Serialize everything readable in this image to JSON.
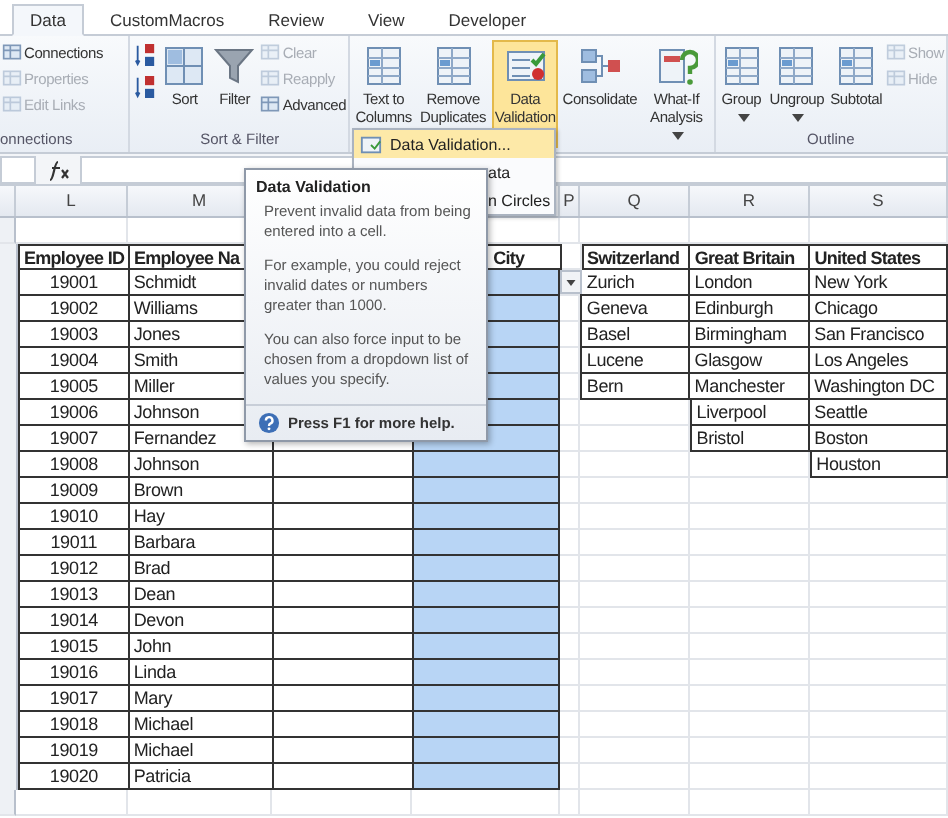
{
  "ribbon": {
    "tabs": [
      {
        "label": "Data",
        "selected": true
      },
      {
        "label": "CustomMacros",
        "selected": false
      },
      {
        "label": "Review",
        "selected": false
      },
      {
        "label": "View",
        "selected": false
      },
      {
        "label": "Developer",
        "selected": false
      }
    ],
    "groups": [
      {
        "label": "onnections",
        "items": [
          {
            "kind": "small",
            "label": "Connections",
            "disabled": false
          },
          {
            "kind": "small",
            "label": "Properties",
            "disabled": true
          },
          {
            "kind": "small",
            "label": "Edit Links",
            "disabled": true
          }
        ]
      },
      {
        "label": "Sort & Filter",
        "items": [
          {
            "kind": "icon"
          },
          {
            "kind": "icon"
          },
          {
            "kind": "large",
            "label": "Sort",
            "dropdown": false,
            "pressed": false
          },
          {
            "kind": "large",
            "label": "Filter",
            "dropdown": false,
            "pressed": false
          },
          {
            "kind": "small",
            "label": "Clear",
            "disabled": true
          },
          {
            "kind": "small",
            "label": "Reapply",
            "disabled": true
          },
          {
            "kind": "small",
            "label": "Advanced",
            "disabled": false
          }
        ]
      },
      {
        "items": [
          {
            "kind": "large",
            "label": "Text to Columns",
            "dropdown": false,
            "pressed": false
          },
          {
            "kind": "large",
            "label": "Remove Duplicates",
            "dropdown": false,
            "pressed": false
          },
          {
            "kind": "large",
            "label": "Data Validation",
            "dropdown": true,
            "pressed": true
          },
          {
            "kind": "large",
            "label": "Consolidate",
            "dropdown": false,
            "pressed": false
          },
          {
            "kind": "large",
            "label": "What-If Analysis",
            "dropdown": true,
            "pressed": false
          }
        ]
      },
      {
        "label": "Outline",
        "items": [
          {
            "kind": "large",
            "label": "Group",
            "dropdown": true,
            "pressed": false
          },
          {
            "kind": "large",
            "label": "Ungroup",
            "dropdown": true,
            "pressed": false
          },
          {
            "kind": "large",
            "label": "Subtotal",
            "dropdown": false,
            "pressed": false
          },
          {
            "kind": "small",
            "label": "Show",
            "disabled": true
          },
          {
            "kind": "small",
            "label": "Hide",
            "disabled": true
          }
        ]
      }
    ]
  },
  "menu": {
    "items": [
      {
        "label": "Data Validation...",
        "highlighted": true
      },
      {
        "label": "ata",
        "highlighted": false
      },
      {
        "label": "n Circles",
        "highlighted": false
      }
    ]
  },
  "tooltip": {
    "title": "Data Validation",
    "paragraphs": [
      "Prevent invalid data from being entered into a cell.",
      "For example, you could reject invalid dates or numbers greater than 1000.",
      "You can also force input to be chosen from a dropdown list of values you specify."
    ],
    "help": "Press F1 for more help."
  },
  "sheet": {
    "column_headers": [
      "L",
      "M",
      "P",
      "Q",
      "R",
      "S"
    ],
    "employees": {
      "headers": {
        "id": "Employee ID",
        "name": "Employee Na",
        "city": "City"
      },
      "city_selected": true,
      "city_dropdown": true,
      "rows": [
        {
          "id": "19001",
          "name": "Schmidt"
        },
        {
          "id": "19002",
          "name": "Williams"
        },
        {
          "id": "19003",
          "name": "Jones"
        },
        {
          "id": "19004",
          "name": "Smith"
        },
        {
          "id": "19005",
          "name": "Miller"
        },
        {
          "id": "19006",
          "name": "Johnson"
        },
        {
          "id": "19007",
          "name": "Fernandez"
        },
        {
          "id": "19008",
          "name": "Johnson"
        },
        {
          "id": "19009",
          "name": "Brown"
        },
        {
          "id": "19010",
          "name": "Hay"
        },
        {
          "id": "19011",
          "name": "Barbara"
        },
        {
          "id": "19012",
          "name": "Brad"
        },
        {
          "id": "19013",
          "name": "Dean"
        },
        {
          "id": "19014",
          "name": "Devon"
        },
        {
          "id": "19015",
          "name": "John"
        },
        {
          "id": "19016",
          "name": "Linda"
        },
        {
          "id": "19017",
          "name": "Mary"
        },
        {
          "id": "19018",
          "name": "Michael"
        },
        {
          "id": "19019",
          "name": "Michael"
        },
        {
          "id": "19020",
          "name": "Patricia"
        }
      ]
    },
    "cities": [
      {
        "header": "Switzerland",
        "values": [
          "Zurich",
          "Geneva",
          "Basel",
          "Lucene",
          "Bern"
        ]
      },
      {
        "header": "Great Britain",
        "values": [
          "London",
          "Edinburgh",
          "Birmingham",
          "Glasgow",
          "Manchester",
          "Liverpool",
          "Bristol"
        ]
      },
      {
        "header": "United States",
        "values": [
          "New York",
          "Chicago",
          "San Francisco",
          "Los Angeles",
          "Washington DC",
          "Seattle",
          "Boston",
          "Houston"
        ]
      }
    ]
  }
}
